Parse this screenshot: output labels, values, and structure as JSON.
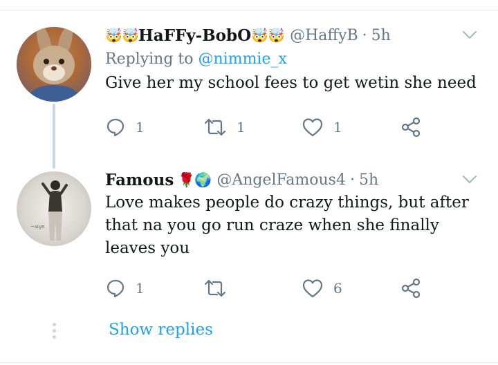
{
  "tweets": [
    {
      "display_name": "HaFFy-BobO",
      "name_emojis_before": [
        "🤯",
        "🤯"
      ],
      "name_emojis_after": [
        "🤯",
        "🤯"
      ],
      "handle": "@HaffyB",
      "separator": "·",
      "time": "5h",
      "replying_prefix": "Replying to ",
      "replying_to": "@nimmie_x",
      "text": "Give her my school fees to get wetin she need",
      "reply_count": "1",
      "retweet_count": "1",
      "like_count": "1"
    },
    {
      "display_name": "Famous",
      "name_emojis_after": [
        "🌹",
        "🌍"
      ],
      "handle": "@AngelFamous4",
      "separator": "·",
      "time": "5h",
      "text": "Love makes people do crazy things, but after that na you go run craze when she finally leaves you",
      "reply_count": "1",
      "retweet_count": "",
      "like_count": "6"
    }
  ],
  "show_replies_label": "Show replies",
  "colors": {
    "accent": "#1da1f2",
    "muted": "#657786",
    "text": "#14171a",
    "divider": "#e1e8ed",
    "thread": "#ccd6dd"
  },
  "icons": [
    "reply-icon",
    "retweet-icon",
    "like-icon",
    "share-icon",
    "chevron-down-icon"
  ]
}
